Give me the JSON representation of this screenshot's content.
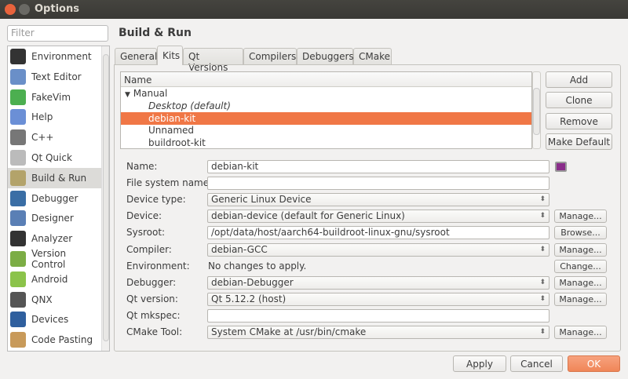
{
  "window": {
    "title": "Options"
  },
  "sidebar": {
    "filter_placeholder": "Filter",
    "items": [
      {
        "label": "Environment",
        "icon": "monitor-icon",
        "color": "#333"
      },
      {
        "label": "Text Editor",
        "icon": "text-editor-icon",
        "color": "#6a8fc8"
      },
      {
        "label": "FakeVim",
        "icon": "fakevim-icon",
        "color": "#4caf50"
      },
      {
        "label": "Help",
        "icon": "help-icon",
        "color": "#6b8fd6"
      },
      {
        "label": "C++",
        "icon": "braces-icon",
        "color": "#777"
      },
      {
        "label": "Qt Quick",
        "icon": "qt-quick-icon",
        "color": "#bbb"
      },
      {
        "label": "Build & Run",
        "icon": "build-run-icon",
        "color": "#b3a36a"
      },
      {
        "label": "Debugger",
        "icon": "debugger-icon",
        "color": "#3a6ea5"
      },
      {
        "label": "Designer",
        "icon": "designer-icon",
        "color": "#5a7fb5"
      },
      {
        "label": "Analyzer",
        "icon": "analyzer-icon",
        "color": "#333"
      },
      {
        "label": "Version Control",
        "icon": "version-control-icon",
        "color": "#7cad45"
      },
      {
        "label": "Android",
        "icon": "android-icon",
        "color": "#8bc34a"
      },
      {
        "label": "QNX",
        "icon": "qnx-icon",
        "color": "#555"
      },
      {
        "label": "Devices",
        "icon": "devices-icon",
        "color": "#2f5f9e"
      },
      {
        "label": "Code Pasting",
        "icon": "code-pasting-icon",
        "color": "#c89a5a"
      }
    ],
    "selected": "Build & Run"
  },
  "main": {
    "heading": "Build & Run",
    "tabs": [
      "General",
      "Kits",
      "Qt Versions",
      "Compilers",
      "Debuggers",
      "CMake"
    ],
    "active_tab": "Kits",
    "tree": {
      "header": "Name",
      "group": "Manual",
      "items": [
        "Desktop (default)",
        "debian-kit",
        "Unnamed",
        "buildroot-kit"
      ],
      "selected": "debian-kit"
    },
    "kit_buttons": [
      "Add",
      "Clone",
      "Remove",
      "Make Default"
    ],
    "form": [
      {
        "label": "Name:",
        "value": "debian-kit",
        "type": "input"
      },
      {
        "label": "File system name:",
        "value": "",
        "type": "input"
      },
      {
        "label": "Device type:",
        "value": "Generic Linux Device",
        "type": "combo"
      },
      {
        "label": "Device:",
        "value": "debian-device (default for Generic Linux)",
        "type": "combo",
        "button": "Manage..."
      },
      {
        "label": "Sysroot:",
        "value": "/opt/data/host/aarch64-buildroot-linux-gnu/sysroot",
        "type": "input",
        "button": "Browse..."
      },
      {
        "label": "Compiler:",
        "value": "debian-GCC",
        "type": "combo",
        "button": "Manage..."
      },
      {
        "label": "Environment:",
        "value": "No changes to apply.",
        "type": "text",
        "button": "Change..."
      },
      {
        "label": "Debugger:",
        "value": "debian-Debugger",
        "type": "combo",
        "button": "Manage..."
      },
      {
        "label": "Qt version:",
        "value": "Qt 5.12.2 (host)",
        "type": "combo",
        "button": "Manage..."
      },
      {
        "label": "Qt mkspec:",
        "value": "",
        "type": "input"
      },
      {
        "label": "CMake Tool:",
        "value": "System CMake at /usr/bin/cmake",
        "type": "combo",
        "button": "Manage..."
      }
    ]
  },
  "footer": {
    "apply": "Apply",
    "cancel": "Cancel",
    "ok": "OK"
  },
  "colors": {
    "accent": "#f07746",
    "titlebar": "#3c3b37"
  }
}
